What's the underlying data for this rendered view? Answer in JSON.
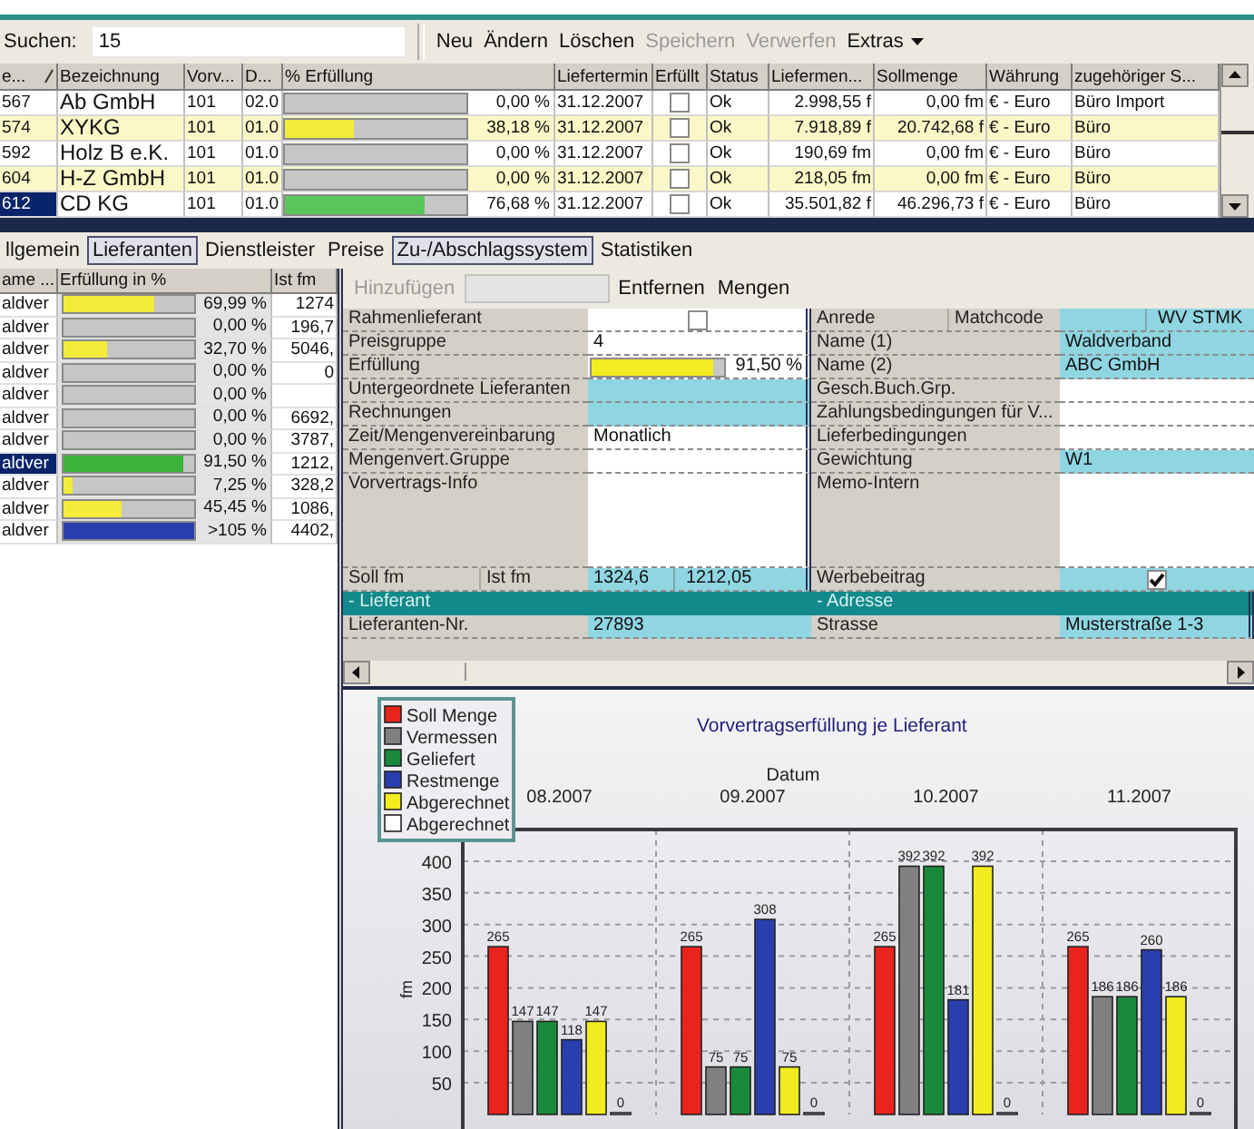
{
  "search": {
    "label": "Suchen:",
    "value": "15"
  },
  "toolbar": [
    {
      "label": "Neu",
      "disabled": false,
      "kind": "button"
    },
    {
      "label": "Ändern",
      "disabled": false,
      "kind": "button"
    },
    {
      "label": "Löschen",
      "disabled": false,
      "kind": "button"
    },
    {
      "label": "Speichern",
      "disabled": true,
      "kind": "button"
    },
    {
      "label": "Verwerfen",
      "disabled": true,
      "kind": "button"
    },
    {
      "label": "Extras",
      "disabled": false,
      "kind": "menu"
    }
  ],
  "grid": {
    "columns": [
      "e...",
      "Bezeichnung",
      "Vorv...",
      "D...",
      "% Erfüllung",
      "Liefertermin",
      "Erfüllt",
      "Status",
      "Liefermen...",
      "Sollmenge",
      "Währung",
      "zugehöriger S..."
    ],
    "rows": [
      {
        "id": "567",
        "name": "Ab GmbH",
        "vorv": "101",
        "d": "02.0",
        "level": 0,
        "percent": "0,00 %",
        "date": "31.12.2007",
        "checked": false,
        "status": "Ok",
        "delivered": "2.998,55 f",
        "target": "0,00 fm",
        "currency": "€ - Euro",
        "site": "Büro Import",
        "highlighted": false,
        "selected": false
      },
      {
        "id": "574",
        "name": "XYKG",
        "vorv": "101",
        "d": "01.0",
        "level": 0.38,
        "color": "#f2ec3a",
        "percent": "38,18 %",
        "date": "31.12.2007",
        "checked": false,
        "status": "Ok",
        "delivered": "7.918,89 f",
        "target": "20.742,68 f",
        "currency": "€ - Euro",
        "site": "Büro",
        "highlighted": true,
        "selected": false
      },
      {
        "id": "592",
        "name": "Holz B e.K.",
        "vorv": "101",
        "d": "01.0",
        "level": 0,
        "percent": "0,00 %",
        "date": "31.12.2007",
        "checked": false,
        "status": "Ok",
        "delivered": "190,69 fm",
        "target": "0,00 fm",
        "currency": "€ - Euro",
        "site": "Büro",
        "highlighted": false,
        "selected": false
      },
      {
        "id": "604",
        "name": "H-Z GmbH",
        "vorv": "101",
        "d": "01.0",
        "level": 0,
        "percent": "0,00 %",
        "date": "31.12.2007",
        "checked": false,
        "status": "Ok",
        "delivered": "218,05 fm",
        "target": "0,00 fm",
        "currency": "€ - Euro",
        "site": "Büro",
        "highlighted": true,
        "selected": false
      },
      {
        "id": "612",
        "name": "CD KG",
        "vorv": "101",
        "d": "01.0",
        "level": 0.77,
        "color": "#5cc45c",
        "percent": "76,68 %",
        "date": "31.12.2007",
        "checked": false,
        "status": "Ok",
        "delivered": "35.501,82 f",
        "target": "46.296,73 f",
        "currency": "€ - Euro",
        "site": "Büro",
        "highlighted": false,
        "selected": true
      }
    ]
  },
  "tabs": [
    {
      "label": "llgemein",
      "selected": false
    },
    {
      "label": "Lieferanten",
      "selected": true
    },
    {
      "label": "Dienstleister",
      "selected": false
    },
    {
      "label": "Preise",
      "selected": false
    },
    {
      "label": "Zu-/Abschlagssystem",
      "selected": true
    },
    {
      "label": "Statistiken",
      "selected": false
    }
  ],
  "suppliers": {
    "columns": [
      "ame ...",
      "Erfüllung in %",
      "Ist fm"
    ],
    "rows": [
      {
        "name": "aldver",
        "level": 0.7,
        "color": "#f2ec3a",
        "percent": "69,99 %",
        "actual": "1274",
        "selected": false
      },
      {
        "name": "aldver",
        "percent": "0,00 %",
        "actual": "196,7",
        "selected": false
      },
      {
        "name": "aldver",
        "level": 0.33,
        "color": "#f2ec3a",
        "percent": "32,70 %",
        "actual": "5046,",
        "selected": false
      },
      {
        "name": "aldver",
        "percent": "0,00 %",
        "actual": "0",
        "selected": false
      },
      {
        "name": "aldver",
        "percent": "0,00 %",
        "selected": false
      },
      {
        "name": "aldver",
        "percent": "0,00 %",
        "actual": "6692,",
        "selected": false
      },
      {
        "name": "aldver",
        "percent": "0,00 %",
        "actual": "3787,",
        "selected": false
      },
      {
        "name": "aldver",
        "level": 0.92,
        "color": "#3cb43c",
        "percent": "91,50 %",
        "actual": "1212,",
        "selected": true
      },
      {
        "name": "aldver",
        "level": 0.07,
        "color": "#f2ec3a",
        "percent": "7,25 %",
        "actual": "328,2",
        "selected": false
      },
      {
        "name": "aldver",
        "level": 0.45,
        "color": "#f2ec3a",
        "percent": "45,45 %",
        "actual": "1086,",
        "selected": false
      },
      {
        "name": "aldver",
        "level": 1,
        "color": "#2a3fae",
        "percent": ">105 %",
        "actual": "4402,",
        "selected": false
      }
    ]
  },
  "form": {
    "toolbar": [
      {
        "label": "Hinzufügen",
        "disabled": true,
        "kind": "button"
      },
      {
        "kind": "field",
        "disabled": true
      },
      {
        "label": "Entfernen",
        "disabled": false,
        "kind": "button"
      },
      {
        "label": "Mengen",
        "disabled": false,
        "kind": "button"
      }
    ],
    "left": [
      {
        "kind": "check",
        "label": "Rahmenlieferant",
        "checked": false,
        "highlighted": false
      },
      {
        "kind": "text",
        "label": "Preisgruppe",
        "value": "4",
        "highlighted": false
      },
      {
        "kind": "bar",
        "label": "Erfüllung",
        "level": 0.915,
        "reading": "91,50 %"
      },
      {
        "kind": "text",
        "label": "Untergeordnete Lieferanten",
        "highlighted": true
      },
      {
        "kind": "text",
        "label": "Rechnungen",
        "highlighted": true
      },
      {
        "kind": "text",
        "label": "Zeit/Mengenvereinbarung",
        "value": "Monatlich",
        "highlighted": false
      },
      {
        "kind": "text",
        "label": "Mengenvert.Gruppe",
        "highlighted": false
      },
      {
        "kind": "memo",
        "label": "Vorvertrags-Info",
        "highlighted": false
      },
      {
        "kind": "pair",
        "label": "Soll fm",
        "label_2": "Ist fm",
        "value": "1324,6",
        "value_2": "1212,05",
        "highlighted": true
      },
      {
        "kind": "section",
        "label": "- Lieferant"
      },
      {
        "kind": "text",
        "label": "Lieferanten-Nr.",
        "value": "27893",
        "highlighted": true
      }
    ],
    "right": [
      {
        "kind": "pair",
        "label": "Anrede",
        "label_2": "Matchcode",
        "value_2": "WV STMK",
        "highlighted": true
      },
      {
        "kind": "text",
        "label": "Name (1)",
        "value": "Waldverband",
        "highlighted": true
      },
      {
        "kind": "text",
        "label": "Name (2)",
        "value": "ABC GmbH",
        "highlighted": true
      },
      {
        "kind": "text",
        "label": "Gesch.Buch.Grp.",
        "highlighted": false
      },
      {
        "kind": "text",
        "label": "Zahlungsbedingungen für V...",
        "highlighted": false
      },
      {
        "kind": "text",
        "label": "Lieferbedingungen",
        "highlighted": false
      },
      {
        "kind": "text",
        "label": "Gewichtung",
        "value": "W1",
        "highlighted": true
      },
      {
        "kind": "memo",
        "label": "Memo-Intern",
        "highlighted": false
      },
      {
        "kind": "check",
        "label": "Werbebeitrag",
        "checked": true,
        "highlighted": true
      },
      {
        "kind": "section",
        "label": "- Adresse"
      },
      {
        "kind": "text",
        "label": "Strasse",
        "value": "Musterstraße 1-3",
        "highlighted": true
      }
    ]
  },
  "chart_data": {
    "type": "bar",
    "grid": true,
    "legend": true,
    "title": "Vorvertragserfüllung je Lieferant",
    "xlabel": "Datum",
    "ylabel": "fm",
    "categories": [
      "08.2007",
      "09.2007",
      "10.2007",
      "11.2007"
    ],
    "ylim": [
      0,
      450
    ],
    "yticks": [
      50,
      100,
      150,
      200,
      250,
      300,
      350,
      400
    ],
    "data_labels": true,
    "series": [
      {
        "name": "Soll Menge",
        "color": "#e8241c",
        "values": [
          265,
          265,
          265,
          265
        ]
      },
      {
        "name": "Vermessen",
        "color": "#808080",
        "values": [
          147,
          75,
          392,
          186
        ]
      },
      {
        "name": "Geliefert",
        "color": "#1a8a3a",
        "values": [
          147,
          75,
          392,
          186
        ]
      },
      {
        "name": "Restmenge",
        "color": "#2a3fae",
        "values": [
          118,
          308,
          181,
          260
        ]
      },
      {
        "name": "Abgerechnet",
        "color": "#f0ec20",
        "values": [
          147,
          75,
          392,
          186
        ]
      },
      {
        "name": "Abgerechnet",
        "color": "#ffffff",
        "values": [
          0,
          0,
          0,
          0
        ]
      }
    ]
  }
}
